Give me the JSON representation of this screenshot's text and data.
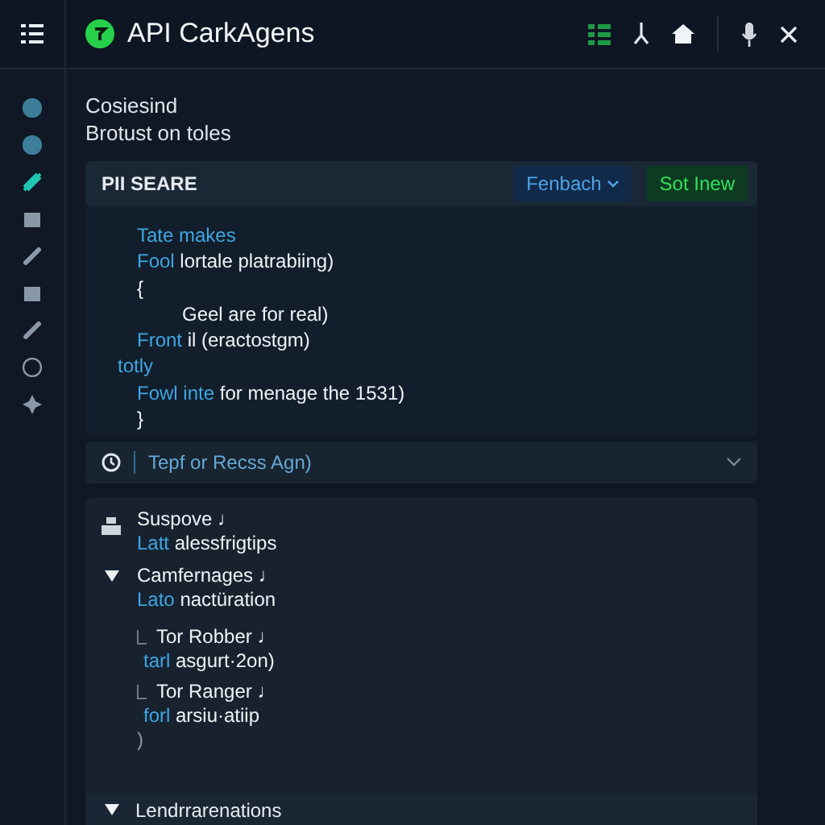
{
  "app_bar": {
    "title": "API CarkAgens"
  },
  "sidebar": {
    "items": [
      {
        "selected": false
      },
      {
        "selected": false
      },
      {
        "selected": true
      },
      {
        "selected": false
      },
      {
        "selected": false
      },
      {
        "selected": false
      },
      {
        "selected": false
      },
      {
        "selected": false
      },
      {
        "selected": false
      }
    ]
  },
  "intro": {
    "title": "Cosiesind",
    "subtitle": "Brotust on toles"
  },
  "code_panel": {
    "title": "PII SEARE",
    "dropdown": "Fenbach",
    "action": "Sot Inew",
    "lines": [
      {
        "kind": "body",
        "keyword": "Tate makes"
      },
      {
        "kind": "body",
        "keyword": "Fool",
        "text": " lortale platrabiing)"
      },
      {
        "kind": "body",
        "text": "{"
      },
      {
        "kind": "inner",
        "text": "Geel are for real)"
      },
      {
        "kind": "body",
        "keyword": "Front",
        "text": " il (eractostgm)"
      },
      {
        "kind": "top",
        "keyword": "totly"
      },
      {
        "kind": "body",
        "keyword": "Fowl inte",
        "text": " for menage the 1531)"
      },
      {
        "kind": "body",
        "text": "}"
      }
    ]
  },
  "search": {
    "value": "Tepf or Recss Agn)"
  },
  "tree": {
    "items": [
      {
        "title": "Suspove ♩",
        "keyword": "Latt",
        "text": " alessfrigtips"
      },
      {
        "title": "Camfernages ♩",
        "keyword": "Lato",
        "text": " nactüration",
        "expanded": true,
        "children": [
          {
            "title": "Tor Robber ♩",
            "keyword": "tarl",
            "text": " asgurt·2on)"
          },
          {
            "title": "Tor Ranger ♩",
            "keyword": "forl",
            "text": " arsiu·atiip"
          }
        ],
        "closing": ")"
      }
    ]
  },
  "footer_item": {
    "title": "Lendrrarenations",
    "expanded": true
  }
}
